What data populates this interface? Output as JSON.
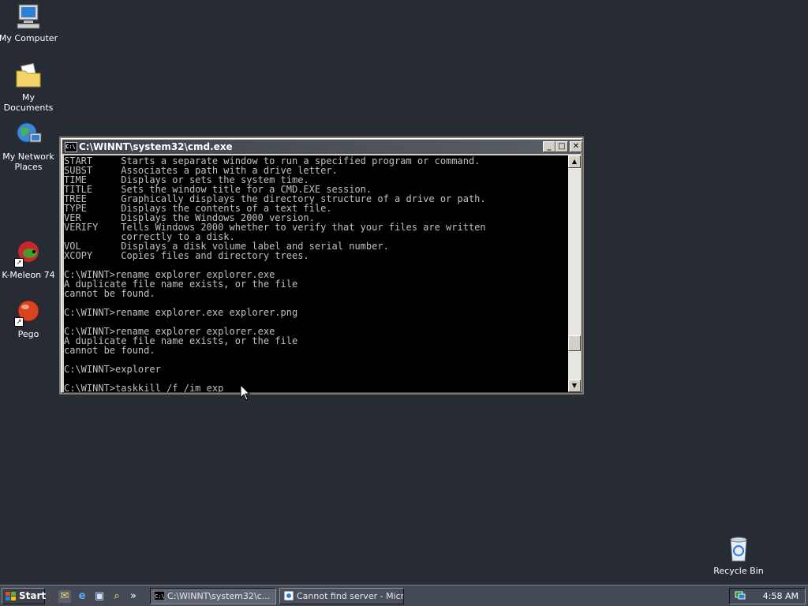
{
  "desktop": {
    "icons": [
      {
        "label": "My Computer"
      },
      {
        "label": "My Documents"
      },
      {
        "label": "My Network Places"
      },
      {
        "label": "K-Meleon 74"
      },
      {
        "label": "Pego"
      },
      {
        "label": "Recycle Bin"
      }
    ]
  },
  "cmd_window": {
    "title": "C:\\WINNT\\system32\\cmd.exe",
    "sysicon_text": "C:\\",
    "minimize_glyph": "_",
    "maximize_glyph": "□",
    "close_glyph": "✕",
    "scroll_up_glyph": "▲",
    "scroll_down_glyph": "▼",
    "console_lines": [
      "START     Starts a separate window to run a specified program or command.",
      "SUBST     Associates a path with a drive letter.",
      "TIME      Displays or sets the system time.",
      "TITLE     Sets the window title for a CMD.EXE session.",
      "TREE      Graphically displays the directory structure of a drive or path.",
      "TYPE      Displays the contents of a text file.",
      "VER       Displays the Windows 2000 version.",
      "VERIFY    Tells Windows 2000 whether to verify that your files are written",
      "          correctly to a disk.",
      "VOL       Displays a disk volume label and serial number.",
      "XCOPY     Copies files and directory trees.",
      "",
      "C:\\WINNT>rename explorer explorer.exe",
      "A duplicate file name exists, or the file",
      "cannot be found.",
      "",
      "C:\\WINNT>rename explorer.exe explorer.png",
      "",
      "C:\\WINNT>rename explorer explorer.exe",
      "A duplicate file name exists, or the file",
      "cannot be found.",
      "",
      "C:\\WINNT>explorer",
      "",
      "C:\\WINNT>taskkill /f /im exp"
    ]
  },
  "taskbar": {
    "start_label": "Start",
    "quick_launch": [
      {
        "icon": "outlook-express-icon",
        "glyph": "✉"
      },
      {
        "icon": "internet-explorer-icon",
        "glyph": "e"
      },
      {
        "icon": "show-desktop-icon",
        "glyph": "▣"
      },
      {
        "icon": "search-icon",
        "glyph": "⌕"
      }
    ],
    "overflow_glyph": "»",
    "tasks": [
      {
        "label": "C:\\WINNT\\system32\\c...",
        "active": true
      },
      {
        "label": "Cannot find server - Micr...",
        "active": false
      }
    ],
    "clock": "4:58 AM"
  },
  "colors": {
    "desktop_bg": "#262b34",
    "console_bg": "#000000",
    "console_fg": "#c0c0c0"
  }
}
